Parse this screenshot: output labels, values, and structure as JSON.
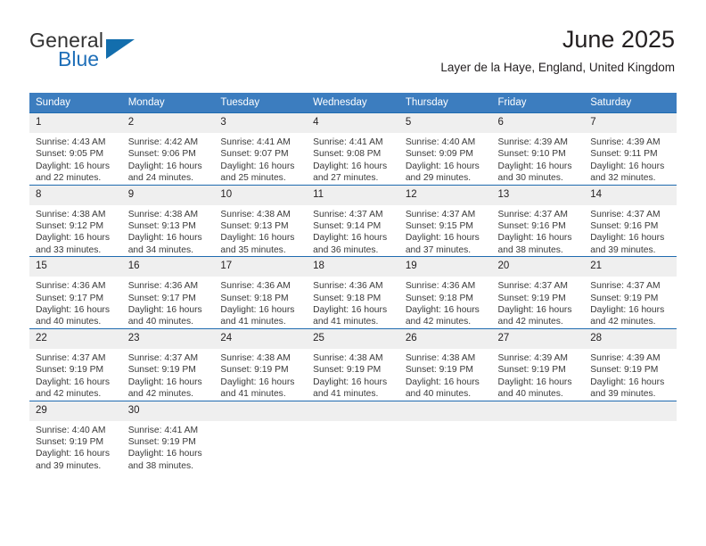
{
  "brand": {
    "word_one": "General",
    "word_two": "Blue",
    "flag_icon": "triangle-flag-icon"
  },
  "header": {
    "title": "June 2025",
    "subtitle": "Layer de la Haye, England, United Kingdom"
  },
  "colors": {
    "header_blue": "#3c7dbf",
    "rule_blue": "#1f6bb0",
    "daynum_gray": "#efefef",
    "brand_blue": "#1f6fb8",
    "text": "#231f20"
  },
  "calendar": {
    "weekday_headers": [
      "Sunday",
      "Monday",
      "Tuesday",
      "Wednesday",
      "Thursday",
      "Friday",
      "Saturday"
    ],
    "labels": {
      "sunrise": "Sunrise:",
      "sunset": "Sunset:",
      "daylight": "Daylight:"
    },
    "weeks": [
      [
        {
          "day": "1",
          "sunrise": "Sunrise: 4:43 AM",
          "sunset": "Sunset: 9:05 PM",
          "daylight_l1": "Daylight: 16 hours",
          "daylight_l2": "and 22 minutes."
        },
        {
          "day": "2",
          "sunrise": "Sunrise: 4:42 AM",
          "sunset": "Sunset: 9:06 PM",
          "daylight_l1": "Daylight: 16 hours",
          "daylight_l2": "and 24 minutes."
        },
        {
          "day": "3",
          "sunrise": "Sunrise: 4:41 AM",
          "sunset": "Sunset: 9:07 PM",
          "daylight_l1": "Daylight: 16 hours",
          "daylight_l2": "and 25 minutes."
        },
        {
          "day": "4",
          "sunrise": "Sunrise: 4:41 AM",
          "sunset": "Sunset: 9:08 PM",
          "daylight_l1": "Daylight: 16 hours",
          "daylight_l2": "and 27 minutes."
        },
        {
          "day": "5",
          "sunrise": "Sunrise: 4:40 AM",
          "sunset": "Sunset: 9:09 PM",
          "daylight_l1": "Daylight: 16 hours",
          "daylight_l2": "and 29 minutes."
        },
        {
          "day": "6",
          "sunrise": "Sunrise: 4:39 AM",
          "sunset": "Sunset: 9:10 PM",
          "daylight_l1": "Daylight: 16 hours",
          "daylight_l2": "and 30 minutes."
        },
        {
          "day": "7",
          "sunrise": "Sunrise: 4:39 AM",
          "sunset": "Sunset: 9:11 PM",
          "daylight_l1": "Daylight: 16 hours",
          "daylight_l2": "and 32 minutes."
        }
      ],
      [
        {
          "day": "8",
          "sunrise": "Sunrise: 4:38 AM",
          "sunset": "Sunset: 9:12 PM",
          "daylight_l1": "Daylight: 16 hours",
          "daylight_l2": "and 33 minutes."
        },
        {
          "day": "9",
          "sunrise": "Sunrise: 4:38 AM",
          "sunset": "Sunset: 9:13 PM",
          "daylight_l1": "Daylight: 16 hours",
          "daylight_l2": "and 34 minutes."
        },
        {
          "day": "10",
          "sunrise": "Sunrise: 4:38 AM",
          "sunset": "Sunset: 9:13 PM",
          "daylight_l1": "Daylight: 16 hours",
          "daylight_l2": "and 35 minutes."
        },
        {
          "day": "11",
          "sunrise": "Sunrise: 4:37 AM",
          "sunset": "Sunset: 9:14 PM",
          "daylight_l1": "Daylight: 16 hours",
          "daylight_l2": "and 36 minutes."
        },
        {
          "day": "12",
          "sunrise": "Sunrise: 4:37 AM",
          "sunset": "Sunset: 9:15 PM",
          "daylight_l1": "Daylight: 16 hours",
          "daylight_l2": "and 37 minutes."
        },
        {
          "day": "13",
          "sunrise": "Sunrise: 4:37 AM",
          "sunset": "Sunset: 9:16 PM",
          "daylight_l1": "Daylight: 16 hours",
          "daylight_l2": "and 38 minutes."
        },
        {
          "day": "14",
          "sunrise": "Sunrise: 4:37 AM",
          "sunset": "Sunset: 9:16 PM",
          "daylight_l1": "Daylight: 16 hours",
          "daylight_l2": "and 39 minutes."
        }
      ],
      [
        {
          "day": "15",
          "sunrise": "Sunrise: 4:36 AM",
          "sunset": "Sunset: 9:17 PM",
          "daylight_l1": "Daylight: 16 hours",
          "daylight_l2": "and 40 minutes."
        },
        {
          "day": "16",
          "sunrise": "Sunrise: 4:36 AM",
          "sunset": "Sunset: 9:17 PM",
          "daylight_l1": "Daylight: 16 hours",
          "daylight_l2": "and 40 minutes."
        },
        {
          "day": "17",
          "sunrise": "Sunrise: 4:36 AM",
          "sunset": "Sunset: 9:18 PM",
          "daylight_l1": "Daylight: 16 hours",
          "daylight_l2": "and 41 minutes."
        },
        {
          "day": "18",
          "sunrise": "Sunrise: 4:36 AM",
          "sunset": "Sunset: 9:18 PM",
          "daylight_l1": "Daylight: 16 hours",
          "daylight_l2": "and 41 minutes."
        },
        {
          "day": "19",
          "sunrise": "Sunrise: 4:36 AM",
          "sunset": "Sunset: 9:18 PM",
          "daylight_l1": "Daylight: 16 hours",
          "daylight_l2": "and 42 minutes."
        },
        {
          "day": "20",
          "sunrise": "Sunrise: 4:37 AM",
          "sunset": "Sunset: 9:19 PM",
          "daylight_l1": "Daylight: 16 hours",
          "daylight_l2": "and 42 minutes."
        },
        {
          "day": "21",
          "sunrise": "Sunrise: 4:37 AM",
          "sunset": "Sunset: 9:19 PM",
          "daylight_l1": "Daylight: 16 hours",
          "daylight_l2": "and 42 minutes."
        }
      ],
      [
        {
          "day": "22",
          "sunrise": "Sunrise: 4:37 AM",
          "sunset": "Sunset: 9:19 PM",
          "daylight_l1": "Daylight: 16 hours",
          "daylight_l2": "and 42 minutes."
        },
        {
          "day": "23",
          "sunrise": "Sunrise: 4:37 AM",
          "sunset": "Sunset: 9:19 PM",
          "daylight_l1": "Daylight: 16 hours",
          "daylight_l2": "and 42 minutes."
        },
        {
          "day": "24",
          "sunrise": "Sunrise: 4:38 AM",
          "sunset": "Sunset: 9:19 PM",
          "daylight_l1": "Daylight: 16 hours",
          "daylight_l2": "and 41 minutes."
        },
        {
          "day": "25",
          "sunrise": "Sunrise: 4:38 AM",
          "sunset": "Sunset: 9:19 PM",
          "daylight_l1": "Daylight: 16 hours",
          "daylight_l2": "and 41 minutes."
        },
        {
          "day": "26",
          "sunrise": "Sunrise: 4:38 AM",
          "sunset": "Sunset: 9:19 PM",
          "daylight_l1": "Daylight: 16 hours",
          "daylight_l2": "and 40 minutes."
        },
        {
          "day": "27",
          "sunrise": "Sunrise: 4:39 AM",
          "sunset": "Sunset: 9:19 PM",
          "daylight_l1": "Daylight: 16 hours",
          "daylight_l2": "and 40 minutes."
        },
        {
          "day": "28",
          "sunrise": "Sunrise: 4:39 AM",
          "sunset": "Sunset: 9:19 PM",
          "daylight_l1": "Daylight: 16 hours",
          "daylight_l2": "and 39 minutes."
        }
      ],
      [
        {
          "day": "29",
          "sunrise": "Sunrise: 4:40 AM",
          "sunset": "Sunset: 9:19 PM",
          "daylight_l1": "Daylight: 16 hours",
          "daylight_l2": "and 39 minutes."
        },
        {
          "day": "30",
          "sunrise": "Sunrise: 4:41 AM",
          "sunset": "Sunset: 9:19 PM",
          "daylight_l1": "Daylight: 16 hours",
          "daylight_l2": "and 38 minutes."
        },
        {
          "day": "",
          "sunrise": "",
          "sunset": "",
          "daylight_l1": "",
          "daylight_l2": "",
          "blank": true
        },
        {
          "day": "",
          "sunrise": "",
          "sunset": "",
          "daylight_l1": "",
          "daylight_l2": "",
          "blank": true
        },
        {
          "day": "",
          "sunrise": "",
          "sunset": "",
          "daylight_l1": "",
          "daylight_l2": "",
          "blank": true
        },
        {
          "day": "",
          "sunrise": "",
          "sunset": "",
          "daylight_l1": "",
          "daylight_l2": "",
          "blank": true
        },
        {
          "day": "",
          "sunrise": "",
          "sunset": "",
          "daylight_l1": "",
          "daylight_l2": "",
          "blank": true
        }
      ]
    ]
  }
}
